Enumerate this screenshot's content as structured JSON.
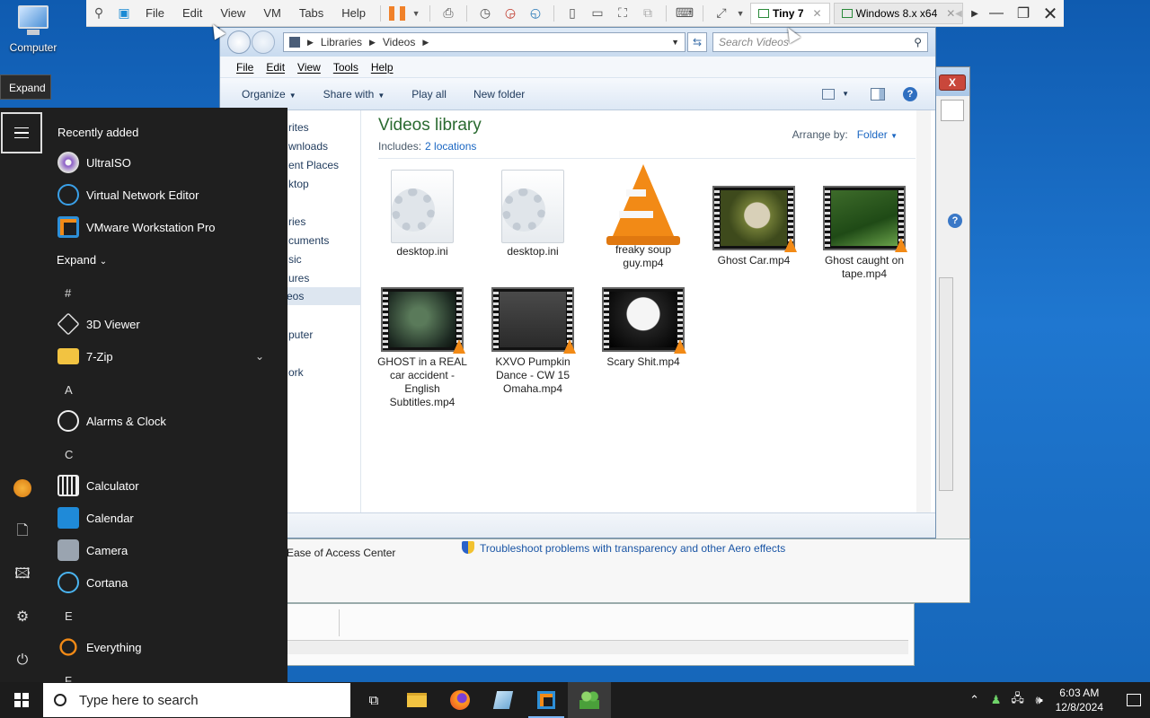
{
  "desktop": {
    "computer_label": "Computer",
    "tooltip": "Expand"
  },
  "vmware": {
    "menus": [
      "File",
      "Edit",
      "View",
      "VM",
      "Tabs",
      "Help"
    ],
    "tabs": [
      {
        "label": "Tiny 7",
        "active": true
      },
      {
        "label": "Windows 8.x x64",
        "active": false
      }
    ],
    "pause_color": "#f0812a"
  },
  "explorer": {
    "breadcrumb": [
      "Libraries",
      "Videos"
    ],
    "search_placeholder": "Search Videos",
    "menu": [
      "File",
      "Edit",
      "View",
      "Tools",
      "Help"
    ],
    "commands": [
      "Organize",
      "Share with",
      "Play all",
      "New folder"
    ],
    "nav_items": [
      "rites",
      "wnloads",
      "ent Places",
      "ktop",
      "ries",
      "cuments",
      "sic",
      "ures",
      "eos",
      "puter",
      "ork"
    ],
    "nav_selected": "eos",
    "library_title": "Videos library",
    "includes_label": "Includes:",
    "includes_link": "2 locations",
    "arrange_label": "Arrange by:",
    "arrange_value": "Folder",
    "files": [
      {
        "name": "desktop.ini",
        "kind": "ini"
      },
      {
        "name": "desktop.ini",
        "kind": "ini"
      },
      {
        "name": "freaky soup guy.mp4",
        "kind": "vlc"
      },
      {
        "name": "Ghost Car.mp4",
        "kind": "video"
      },
      {
        "name": "Ghost caught on tape.mp4",
        "kind": "video"
      },
      {
        "name": "GHOST in a REAL car accident - English Subtitles.mp4",
        "kind": "video"
      },
      {
        "name": "KXVO Pumpkin Dance - CW 15 Omaha.mp4",
        "kind": "video"
      },
      {
        "name": "Scary Shit.mp4",
        "kind": "video"
      }
    ]
  },
  "background_window": {
    "ease_link": "Ease of Access Center",
    "troubleshoot_link": "Troubleshoot problems with transparency and other Aero effects",
    "close_label": "X"
  },
  "start_menu": {
    "recently_added_label": "Recently added",
    "recent_apps": [
      "UltraISO",
      "Virtual Network Editor",
      "VMware Workstation Pro"
    ],
    "expand_label": "Expand",
    "sections": [
      {
        "letter": "#",
        "apps": [
          "3D Viewer",
          "7-Zip"
        ]
      },
      {
        "letter": "A",
        "apps": [
          "Alarms & Clock"
        ]
      },
      {
        "letter": "C",
        "apps": [
          "Calculator",
          "Calendar",
          "Camera",
          "Cortana"
        ]
      },
      {
        "letter": "E",
        "apps": [
          "Everything"
        ]
      },
      {
        "letter": "F",
        "apps": []
      }
    ]
  },
  "taskbar": {
    "search_placeholder": "Type here to search",
    "time": "6:03 AM",
    "date": "12/8/2024"
  }
}
